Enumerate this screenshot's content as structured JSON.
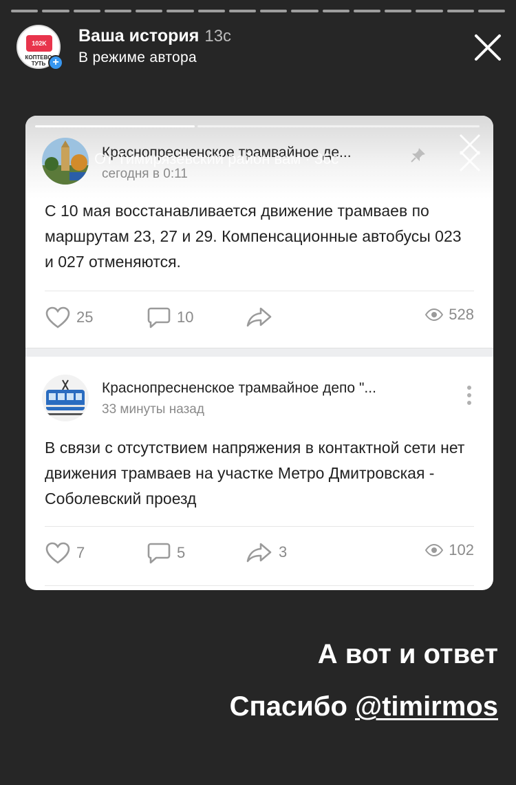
{
  "story": {
    "segments_total": 16,
    "title": "Ваша история",
    "time": "13с",
    "subtitle": "В режиме автора",
    "avatar_text": "КОПТЕВО ТУТЬ",
    "avatar_badge": "102K"
  },
  "screenshot": {
    "ghost_overlay_text": "От Тимирязевский район вам · 36с",
    "posts": [
      {
        "author": "Краснопресненское трамвайное де...",
        "time": "сегодня в 0:11",
        "text": "С 10 мая восстанавливается движение трамваев по маршрутам 23, 27 и 29. Компенсационные автобусы 023 и 027 отменяются.",
        "likes": "25",
        "comments": "10",
        "shares": "",
        "views": "528"
      },
      {
        "author": "Краснопресненское трамвайное депо \"...",
        "time": "33 минуты назад",
        "text": "В связи с отсутствием напряжения в контактной сети нет движения трамваев на участке Метро Дмитровская - Соболевский проезд",
        "likes": "7",
        "comments": "5",
        "shares": "3",
        "views": "102"
      }
    ]
  },
  "captions": {
    "line1": "А вот и ответ",
    "line2_prefix": "Спасибо ",
    "mention": "@timirmos"
  },
  "colors": {
    "background": "#262626",
    "card": "#ffffff",
    "accent_badge": "#3897f0",
    "avatar_heart": "#e8344c"
  },
  "icons": [
    "close-icon",
    "heart-icon",
    "comment-icon",
    "share-icon",
    "eye-icon",
    "pin-icon",
    "more-icon",
    "plus-icon"
  ]
}
